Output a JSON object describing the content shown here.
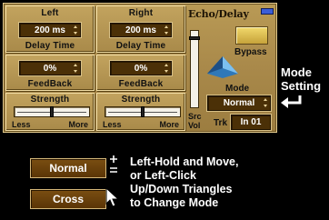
{
  "plugin": {
    "title": "Echo/Delay",
    "left": {
      "header": "Left",
      "delay_value": "200 ms",
      "delay_label": "Delay Time",
      "feedback_value": "0%",
      "feedback_label": "FeedBack",
      "strength_label": "Strength",
      "less": "Less",
      "more": "More",
      "strength_level": 0.5
    },
    "right": {
      "header": "Right",
      "delay_value": "200 ms",
      "delay_label": "Delay Time",
      "feedback_value": "0%",
      "feedback_label": "FeedBack",
      "strength_label": "Strength",
      "less": "Less",
      "more": "More",
      "strength_level": 0.5
    },
    "src_vol_label_line1": "Src",
    "src_vol_label_line2": "Vol",
    "src_vol_level": 0.92,
    "bypass_label": "Bypass",
    "mode_label": "Mode",
    "mode_value": "Normal",
    "trk_label": "Trk",
    "trk_value": "In 01",
    "colors": {
      "panel": "#a9894a",
      "value_box": "#4b3007",
      "led": "#3b5ed8",
      "bypass": "#e0c050",
      "pyramid": "#2f78b8"
    }
  },
  "annotations": {
    "mode_setting_line1": "Mode",
    "mode_setting_line2": "Setting",
    "help_line1": "Left-Hold and Move,",
    "help_line2": "or Left-Click",
    "help_line3": "Up/Down Triangles",
    "help_line4": "to Change Mode",
    "example_normal": "Normal",
    "example_cross": "Cross",
    "icons": [
      "arrow-left-icon",
      "plus-minus-icon",
      "mouse-cursor-icon"
    ]
  }
}
